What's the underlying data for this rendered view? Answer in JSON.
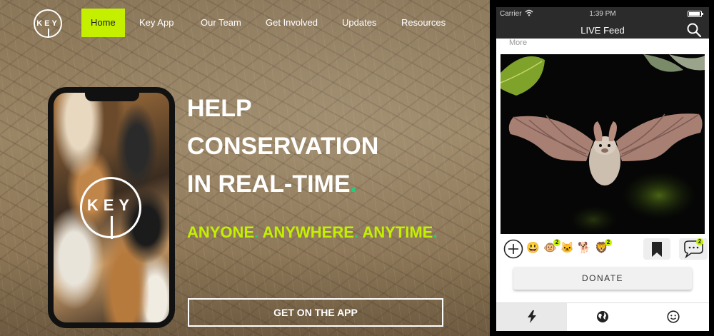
{
  "site": {
    "logo_text": "KEY",
    "nav": [
      "Home",
      "Key App",
      "Our Team",
      "Get Involved",
      "Updates",
      "Resources"
    ],
    "active_nav": "Home",
    "phone_logo_text": "KEY",
    "headline_lines": [
      "HELP",
      "CONSERVATION",
      "IN REAL-TIME"
    ],
    "headline_dot": ".",
    "tagline": [
      "ANYONE",
      "ANYWHERE",
      "ANYTIME"
    ],
    "tagline_sep": ".",
    "cta_label": "GET ON THE APP",
    "colors": {
      "accent": "#c4f000",
      "dot": "#19d37a"
    }
  },
  "app": {
    "status": {
      "carrier": "Carrier",
      "time": "1:39 PM"
    },
    "title": "LIVE Feed",
    "more_label": "More",
    "reactions": [
      {
        "emoji": "😃",
        "count": ""
      },
      {
        "emoji": "🐵",
        "count": "2"
      },
      {
        "emoji": "🐱",
        "count": ""
      },
      {
        "emoji": "🐕",
        "count": ""
      },
      {
        "emoji": "🦁",
        "count": "2"
      }
    ],
    "comment_count": "2",
    "donate_label": "DONATE",
    "tabs": [
      "feed-bolt-icon",
      "globe-icon",
      "smile-icon"
    ],
    "active_tab": 0
  }
}
